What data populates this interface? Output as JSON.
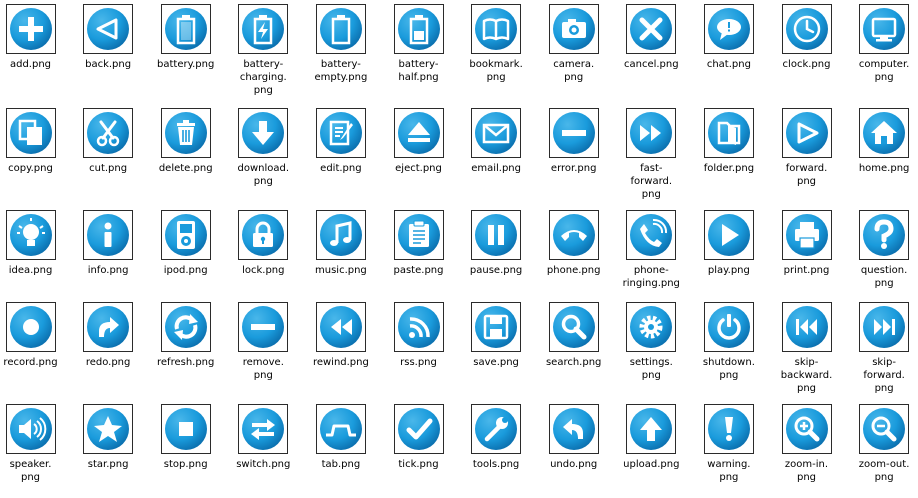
{
  "icon_color": "#1a9bdc",
  "icon_color_light": "#49b7ea",
  "icon_color_dark": "#0b6fae",
  "rows": [
    [
      {
        "label": "add.png",
        "icon": "add-icon"
      },
      {
        "label": "back.png",
        "icon": "back-icon"
      },
      {
        "label": "battery.png",
        "icon": "battery-icon"
      },
      {
        "label": "battery-\ncharging.\npng",
        "icon": "battery-charging-icon"
      },
      {
        "label": "battery-\nempty.png",
        "icon": "battery-empty-icon"
      },
      {
        "label": "battery-\nhalf.png",
        "icon": "battery-half-icon"
      },
      {
        "label": "bookmark.\npng",
        "icon": "bookmark-icon"
      },
      {
        "label": "camera.\npng",
        "icon": "camera-icon"
      },
      {
        "label": "cancel.png",
        "icon": "cancel-icon"
      },
      {
        "label": "chat.png",
        "icon": "chat-icon"
      },
      {
        "label": "clock.png",
        "icon": "clock-icon"
      },
      {
        "label": "computer.\npng",
        "icon": "computer-icon"
      }
    ],
    [
      {
        "label": "copy.png",
        "icon": "copy-icon"
      },
      {
        "label": "cut.png",
        "icon": "cut-icon"
      },
      {
        "label": "delete.png",
        "icon": "delete-icon"
      },
      {
        "label": "download.\npng",
        "icon": "download-icon"
      },
      {
        "label": "edit.png",
        "icon": "edit-icon"
      },
      {
        "label": "eject.png",
        "icon": "eject-icon"
      },
      {
        "label": "email.png",
        "icon": "email-icon"
      },
      {
        "label": "error.png",
        "icon": "error-icon"
      },
      {
        "label": "fast-\nforward.\npng",
        "icon": "fast-forward-icon"
      },
      {
        "label": "folder.png",
        "icon": "folder-icon"
      },
      {
        "label": "forward.\npng",
        "icon": "forward-icon"
      },
      {
        "label": "home.png",
        "icon": "home-icon"
      }
    ],
    [
      {
        "label": "idea.png",
        "icon": "idea-icon"
      },
      {
        "label": "info.png",
        "icon": "info-icon"
      },
      {
        "label": "ipod.png",
        "icon": "ipod-icon"
      },
      {
        "label": "lock.png",
        "icon": "lock-icon"
      },
      {
        "label": "music.png",
        "icon": "music-icon"
      },
      {
        "label": "paste.png",
        "icon": "paste-icon"
      },
      {
        "label": "pause.png",
        "icon": "pause-icon"
      },
      {
        "label": "phone.png",
        "icon": "phone-icon"
      },
      {
        "label": "phone-\nringing.png",
        "icon": "phone-ringing-icon"
      },
      {
        "label": "play.png",
        "icon": "play-icon"
      },
      {
        "label": "print.png",
        "icon": "print-icon"
      },
      {
        "label": "question.\npng",
        "icon": "question-icon"
      }
    ],
    [
      {
        "label": "record.png",
        "icon": "record-icon"
      },
      {
        "label": "redo.png",
        "icon": "redo-icon"
      },
      {
        "label": "refresh.png",
        "icon": "refresh-icon"
      },
      {
        "label": "remove.\npng",
        "icon": "remove-icon"
      },
      {
        "label": "rewind.png",
        "icon": "rewind-icon"
      },
      {
        "label": "rss.png",
        "icon": "rss-icon"
      },
      {
        "label": "save.png",
        "icon": "save-icon"
      },
      {
        "label": "search.png",
        "icon": "search-icon"
      },
      {
        "label": "settings.\npng",
        "icon": "settings-icon"
      },
      {
        "label": "shutdown.\npng",
        "icon": "shutdown-icon"
      },
      {
        "label": "skip-\nbackward.\npng",
        "icon": "skip-backward-icon"
      },
      {
        "label": "skip-\nforward.\npng",
        "icon": "skip-forward-icon"
      }
    ],
    [
      {
        "label": "speaker.\npng",
        "icon": "speaker-icon"
      },
      {
        "label": "star.png",
        "icon": "star-icon"
      },
      {
        "label": "stop.png",
        "icon": "stop-icon"
      },
      {
        "label": "switch.png",
        "icon": "switch-icon"
      },
      {
        "label": "tab.png",
        "icon": "tab-icon"
      },
      {
        "label": "tick.png",
        "icon": "tick-icon"
      },
      {
        "label": "tools.png",
        "icon": "tools-icon"
      },
      {
        "label": "undo.png",
        "icon": "undo-icon"
      },
      {
        "label": "upload.png",
        "icon": "upload-icon"
      },
      {
        "label": "warning.\npng",
        "icon": "warning-icon"
      },
      {
        "label": "zoom-in.\npng",
        "icon": "zoom-in-icon"
      },
      {
        "label": "zoom-out.\npng",
        "icon": "zoom-out-icon"
      }
    ]
  ]
}
